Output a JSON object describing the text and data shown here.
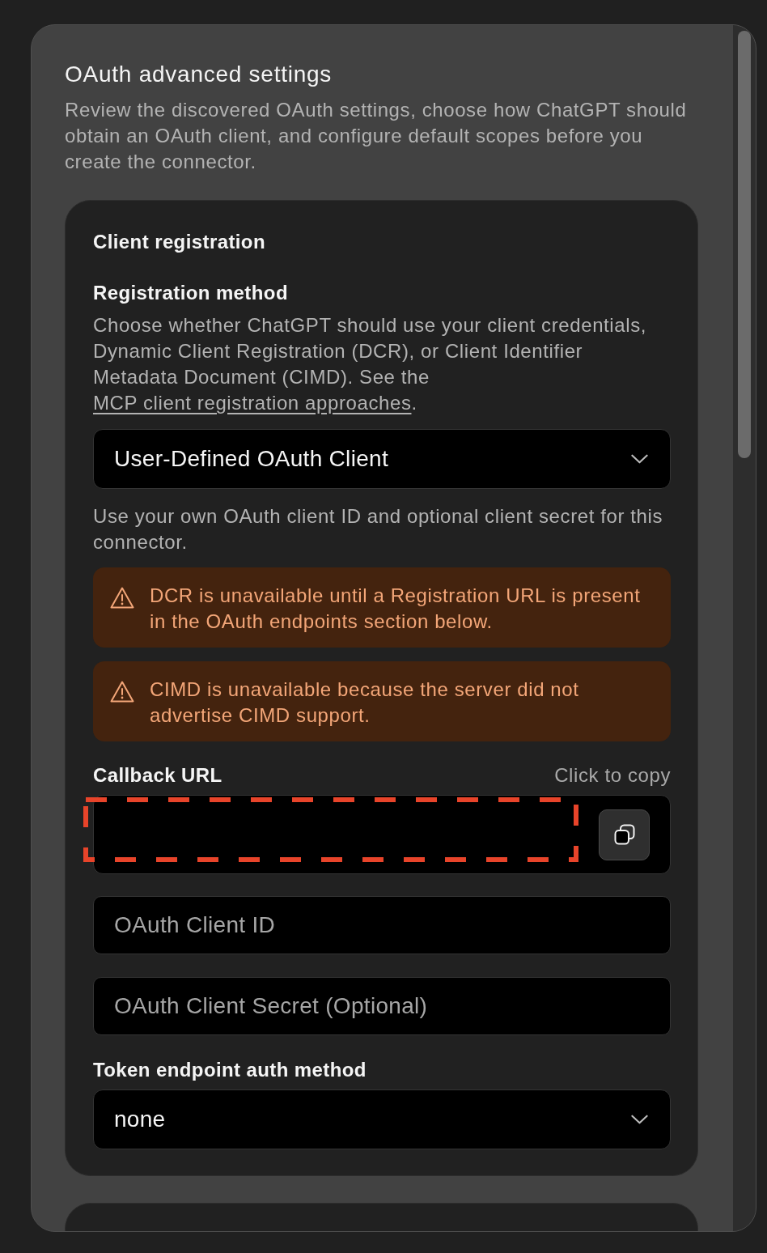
{
  "dialog": {
    "title": "OAuth advanced settings",
    "description": "Review the discovered OAuth settings, choose how ChatGPT should obtain an OAuth client, and configure default scopes before you create the connector."
  },
  "client_registration": {
    "heading": "Client registration",
    "registration_method": {
      "label": "Registration method",
      "description": "Choose whether ChatGPT should use your client credentials, Dynamic Client Registration (DCR), or Client Identifier Metadata Document (CIMD). See the",
      "link": "MCP client registration approaches",
      "description_end": ".",
      "select_value": "User-Defined OAuth Client",
      "help": "Use your own OAuth client ID and optional client secret for this connector."
    },
    "warnings": [
      {
        "text": "DCR is unavailable until a Registration URL is present in the OAuth endpoints section below."
      },
      {
        "text": "CIMD is unavailable because the server did not advertise CIMD support."
      }
    ],
    "callback_url": {
      "label": "Callback URL",
      "hint": "Click to copy",
      "redacted": true
    },
    "fields": [
      {
        "placeholder": "OAuth Client ID"
      },
      {
        "placeholder": "OAuth Client Secret (Optional)"
      }
    ],
    "token_endpoint_auth": {
      "label": "Token endpoint auth method",
      "select_value": "none"
    }
  }
}
